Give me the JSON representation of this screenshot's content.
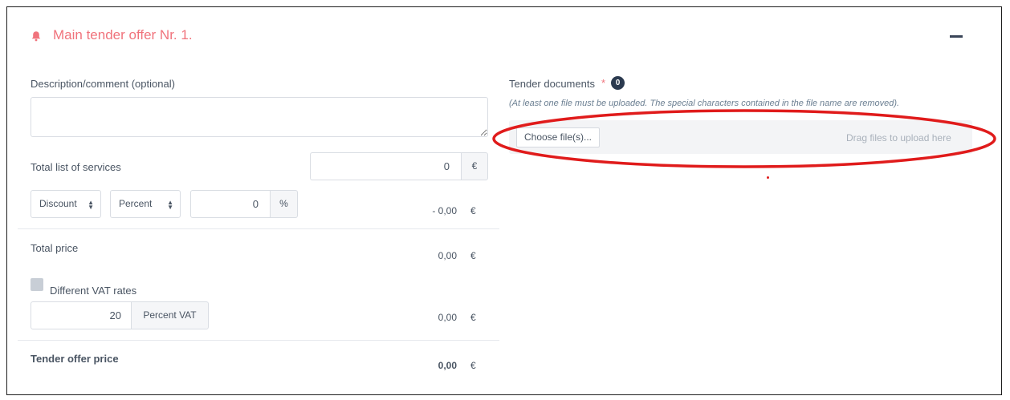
{
  "header": {
    "title": "Main tender offer  Nr. 1.",
    "icon": "bell-icon",
    "accent_color": "#f0737c"
  },
  "form": {
    "description_label": "Description/comment (optional)",
    "description_value": "",
    "total_services_label": "Total list of services",
    "total_services_value": "0",
    "currency_addon": "€",
    "discount_type": "Discount",
    "discount_mode": "Percent",
    "discount_value": "0",
    "percent_addon": "%",
    "discount_result": "- 0,00",
    "currency": "€",
    "total_price_label": "Total price",
    "total_price_value": "0,00",
    "vat_checkbox_label": "Different VAT rates",
    "vat_checked": false,
    "vat_rate_value": "20",
    "vat_addon": "Percent VAT",
    "vat_amount": "0,00",
    "offer_price_label": "Tender offer price",
    "offer_price_value": "0,00"
  },
  "documents": {
    "label": "Tender documents",
    "required_mark": "*",
    "count": "0",
    "hint": "(At least one file must be uploaded. The special characters contained in the file name are removed).",
    "choose_button": "Choose file(s)...",
    "drop_hint": "Drag files to upload here"
  },
  "annotation": {
    "color": "#e01b1b",
    "shape": "ellipse-highlight"
  }
}
